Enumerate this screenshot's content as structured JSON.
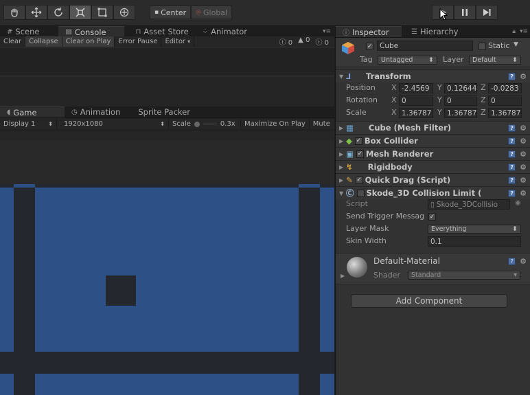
{
  "toolbar": {
    "tools": [
      "hand-tool",
      "move-tool",
      "rotate-tool",
      "scale-tool",
      "rect-tool",
      "transform-tool"
    ],
    "pivot_label": "Center",
    "space_label": "Global"
  },
  "scene_tabs": {
    "scene": "Scene",
    "console": "Console",
    "asset_store": "Asset Store",
    "animator": "Animator"
  },
  "console_bar": {
    "clear": "Clear",
    "collapse": "Collapse",
    "clear_on_play": "Clear on Play",
    "error_pause": "Error Pause",
    "editor": "Editor",
    "info_count": "0",
    "warn_count": "0",
    "error_count": "0"
  },
  "game_tabs": {
    "game": "Game",
    "animation": "Animation",
    "sprite_packer": "Sprite Packer"
  },
  "game_bar": {
    "display": "Display 1",
    "resolution": "1920x1080",
    "scale_label": "Scale",
    "scale_value": "0.3x",
    "maximize": "Maximize On Play",
    "mute": "Mute"
  },
  "right_tabs": {
    "inspector": "Inspector",
    "hierarchy": "Hierarchy"
  },
  "object": {
    "name": "Cube",
    "static": "Static",
    "tag_label": "Tag",
    "tag_value": "Untagged",
    "layer_label": "Layer",
    "layer_value": "Default"
  },
  "transform": {
    "title": "Transform",
    "position_label": "Position",
    "rotation_label": "Rotation",
    "scale_label": "Scale",
    "axis_x": "X",
    "axis_y": "Y",
    "axis_z": "Z",
    "position": [
      "-2.4569",
      "0.12644",
      "-0.0283"
    ],
    "rotation": [
      "0",
      "0",
      "0"
    ],
    "scale": [
      "1.36787",
      "1.36787",
      "1.36787"
    ]
  },
  "components": {
    "mesh_filter": "Cube (Mesh Filter)",
    "box_collider": "Box Collider",
    "mesh_renderer": "Mesh Renderer",
    "rigidbody": "Rigidbody",
    "quick_drag": "Quick Drag (Script)",
    "skode": "Skode_3D Collision Limit ("
  },
  "skode_fields": {
    "script_label": "Script",
    "script_value": "Skode_3DCollisio",
    "send_trigger_label": "Send Trigger Messag",
    "layer_mask_label": "Layer Mask",
    "layer_mask_value": "Everything",
    "skin_width_label": "Skin Width",
    "skin_width_value": "0.1"
  },
  "material": {
    "name": "Default-Material",
    "shader_label": "Shader",
    "shader_value": "Standard"
  },
  "add_component": "Add Component",
  "colors": {
    "game_blue": "#2d5187",
    "game_dark": "#24272e",
    "editor_bg": "#1e1e1e",
    "panel_bg": "#323232"
  }
}
